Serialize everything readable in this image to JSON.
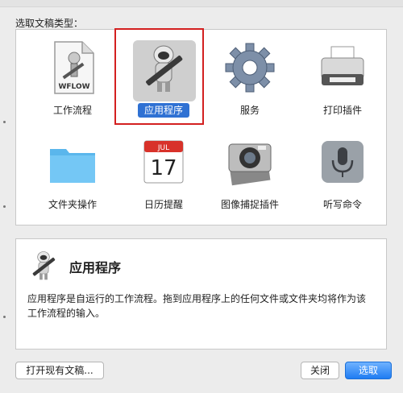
{
  "prompt_label": "选取文稿类型：",
  "items": [
    {
      "id": "workflow",
      "label": "工作流程",
      "icon": "workflow-document-icon",
      "badge": "WFLOW"
    },
    {
      "id": "application",
      "label": "应用程序",
      "icon": "automator-robot-icon",
      "selected": true
    },
    {
      "id": "service",
      "label": "服务",
      "icon": "gear-icon"
    },
    {
      "id": "print-plugin",
      "label": "打印插件",
      "icon": "printer-icon"
    },
    {
      "id": "folder-action",
      "label": "文件夹操作",
      "icon": "folder-icon"
    },
    {
      "id": "calendar-alarm",
      "label": "日历提醒",
      "icon": "calendar-icon",
      "month": "JUL",
      "day": "17"
    },
    {
      "id": "image-capture",
      "label": "图像捕捉插件",
      "icon": "camera-icon"
    },
    {
      "id": "dictation",
      "label": "听写命令",
      "icon": "microphone-icon"
    }
  ],
  "description": {
    "title": "应用程序",
    "text": "应用程序是自运行的工作流程。拖到应用程序上的任何文件或文件夹均将作为该工作流程的输入。"
  },
  "buttons": {
    "open_existing": "打开现有文稿...",
    "close": "关闭",
    "choose": "选取"
  },
  "colors": {
    "selection": "#2f71d3",
    "highlight_box": "#d32020",
    "primary_button": "#1f7cf2"
  }
}
